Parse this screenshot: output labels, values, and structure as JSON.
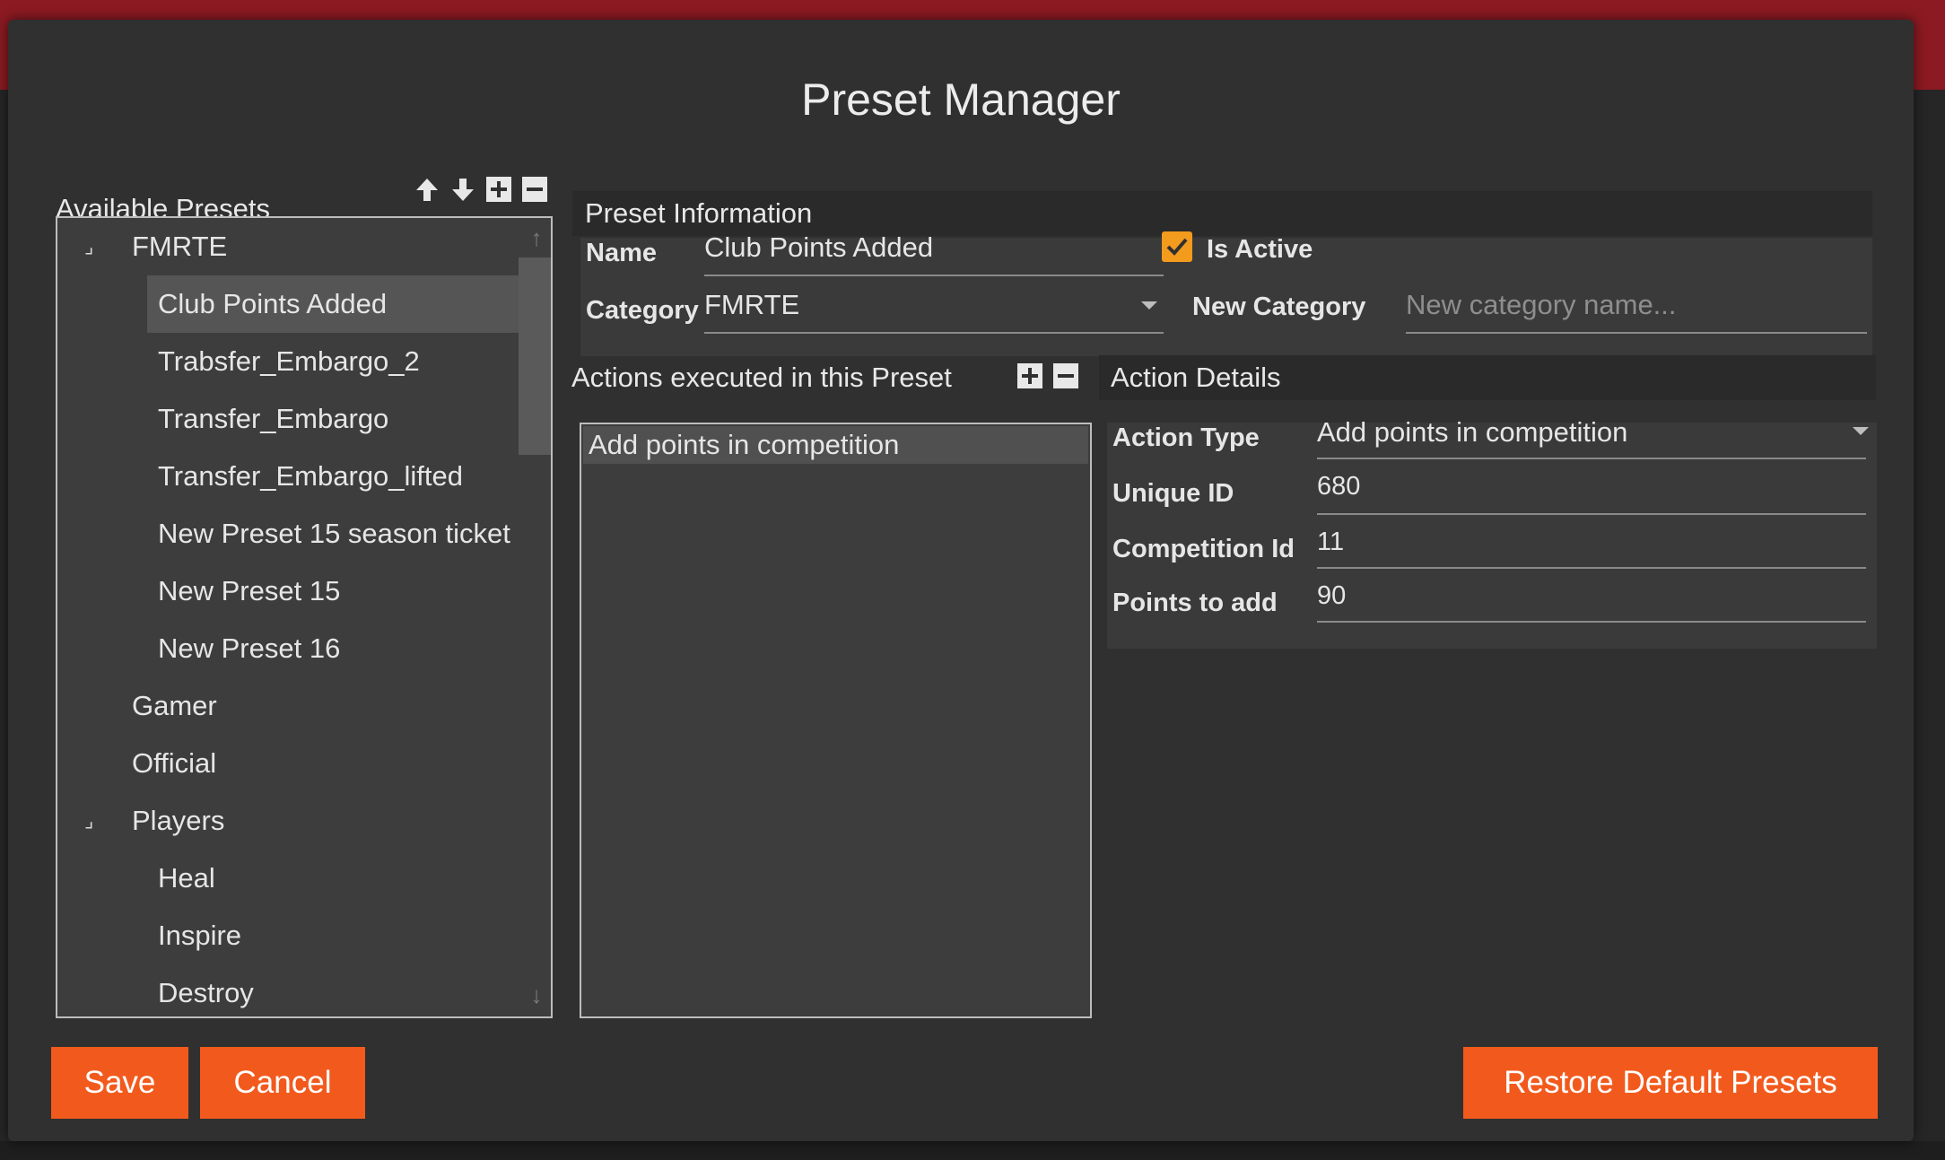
{
  "dialog": {
    "title": "Preset Manager"
  },
  "available_presets": {
    "header": "Available Presets",
    "tree": [
      {
        "label": "FMRTE",
        "level": 0,
        "expander": "⌟"
      },
      {
        "label": "Club Points Added",
        "level": 1,
        "selected": true
      },
      {
        "label": "Trabsfer_Embargo_2",
        "level": 1
      },
      {
        "label": "Transfer_Embargo",
        "level": 1
      },
      {
        "label": "Transfer_Embargo_lifted",
        "level": 1
      },
      {
        "label": "New Preset 15 season ticket",
        "level": 1
      },
      {
        "label": "New Preset 15",
        "level": 1
      },
      {
        "label": "New Preset 16",
        "level": 1
      },
      {
        "label": "Gamer",
        "level": 0
      },
      {
        "label": "Official",
        "level": 0
      },
      {
        "label": "Players",
        "level": 0,
        "expander": "⌟"
      },
      {
        "label": "Heal",
        "level": 1
      },
      {
        "label": "Inspire",
        "level": 1
      },
      {
        "label": "Destroy",
        "level": 1
      }
    ]
  },
  "preset_info": {
    "header": "Preset Information",
    "name_label": "Name",
    "name_value": "Club Points Added",
    "is_active_label": "Is Active",
    "is_active": true,
    "category_label": "Category",
    "category_value": "FMRTE",
    "new_category_label": "New Category",
    "new_category_placeholder": "New category name..."
  },
  "actions": {
    "header": "Actions executed in this Preset",
    "items": [
      "Add points in competition"
    ]
  },
  "action_details": {
    "header": "Action Details",
    "action_type_label": "Action Type",
    "action_type_value": "Add points in competition",
    "unique_id_label": "Unique ID",
    "unique_id_value": "680",
    "competition_id_label": "Competition Id",
    "competition_id_value": "11",
    "points_label": "Points to add",
    "points_value": "90"
  },
  "buttons": {
    "save": "Save",
    "cancel": "Cancel",
    "restore": "Restore Default Presets"
  },
  "colors": {
    "accent_button": "#f25a1d",
    "checkbox": "#f29b1d",
    "backdrop_header": "#8c1a22"
  }
}
